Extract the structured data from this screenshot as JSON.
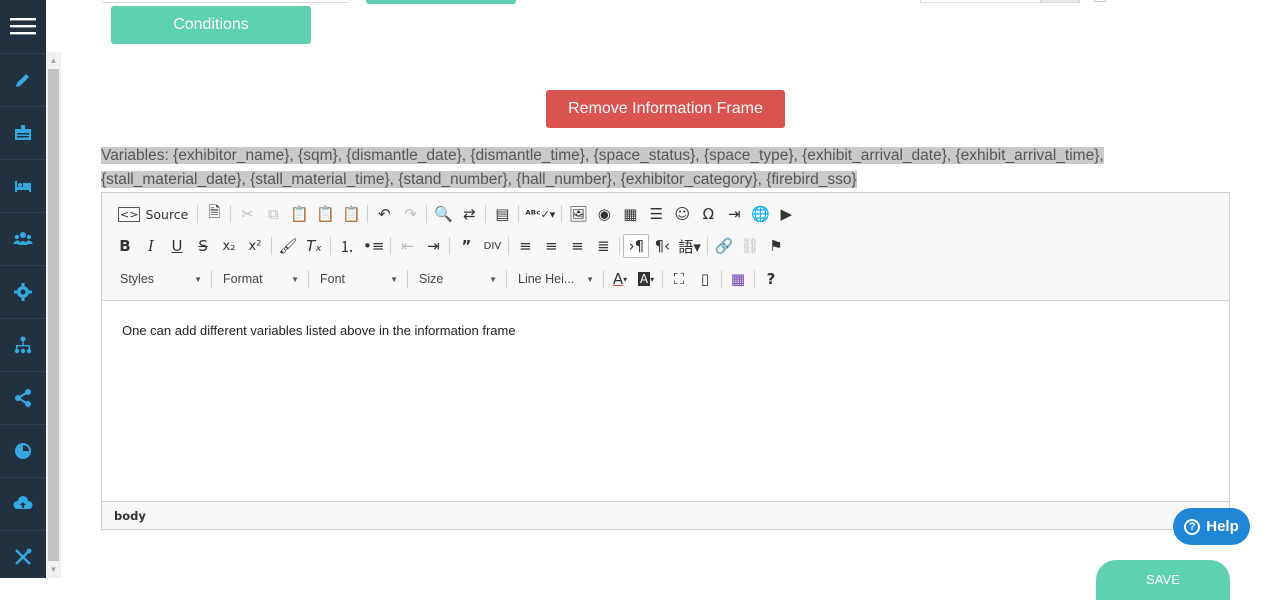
{
  "buttons": {
    "conditions": "Conditions",
    "remove_frame": "Remove Information Frame",
    "save": "SAVE"
  },
  "variables_label": "Variables: {exhibitor_name}, {sqm}, {dismantle_date}, {dismantle_time}, {space_status}, {space_type}, {exhibit_arrival_date}, {exhibit_arrival_time}, {stall_material_date}, {stall_material_time}, {stand_number}, {hall_number}, {exhibitor_category}, {firebird_sso}",
  "editor": {
    "source_label": "Source",
    "combos": {
      "styles": "Styles",
      "format": "Format",
      "font": "Font",
      "size": "Size",
      "line_height": "Line Hei..."
    },
    "content": "One can add different variables listed above in the information frame",
    "status": "body"
  },
  "help_label": "Help",
  "colors": {
    "sidebar": "#22313f",
    "accent_green": "#5ed1b0",
    "danger": "#d9534f",
    "help_blue": "#1f87d6",
    "icon_blue": "#35a8e0"
  },
  "sidebar_icons": [
    "pencil-icon",
    "id-card-icon",
    "bed-icon",
    "users-icon",
    "gear-icon",
    "org-chart-icon",
    "share-icon",
    "pie-chart-icon",
    "cloud-upload-icon",
    "tools-icon"
  ]
}
